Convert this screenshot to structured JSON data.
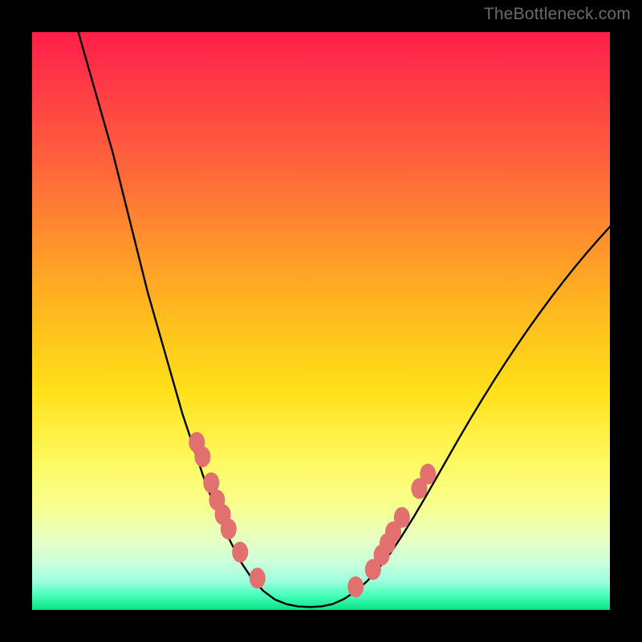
{
  "watermark": "TheBottleneck.com",
  "chart_data": {
    "type": "line",
    "title": "",
    "xlabel": "",
    "ylabel": "",
    "xlim": [
      0,
      100
    ],
    "ylim": [
      0,
      100
    ],
    "curve": {
      "points": [
        [
          8,
          100
        ],
        [
          10,
          93
        ],
        [
          12,
          86
        ],
        [
          14,
          79
        ],
        [
          16,
          71
        ],
        [
          18,
          63
        ],
        [
          20,
          55
        ],
        [
          22,
          48
        ],
        [
          24,
          41
        ],
        [
          26,
          34
        ],
        [
          28,
          28
        ],
        [
          30,
          22
        ],
        [
          32,
          17
        ],
        [
          34,
          12.5
        ],
        [
          36,
          8.5
        ],
        [
          38,
          5.5
        ],
        [
          40,
          3.3
        ],
        [
          42,
          1.8
        ],
        [
          44,
          1.0
        ],
        [
          46,
          0.6
        ],
        [
          48,
          0.5
        ],
        [
          50,
          0.6
        ],
        [
          52,
          1.0
        ],
        [
          54,
          1.9
        ],
        [
          56,
          3.2
        ],
        [
          58,
          5.0
        ],
        [
          60,
          7.2
        ],
        [
          62,
          9.8
        ],
        [
          64,
          12.8
        ],
        [
          66,
          16.0
        ],
        [
          68,
          19.4
        ],
        [
          70,
          22.9
        ],
        [
          72,
          26.4
        ],
        [
          74,
          29.9
        ],
        [
          76,
          33.3
        ],
        [
          78,
          36.6
        ],
        [
          80,
          39.8
        ],
        [
          82,
          42.9
        ],
        [
          84,
          45.9
        ],
        [
          86,
          48.8
        ],
        [
          88,
          51.6
        ],
        [
          90,
          54.3
        ],
        [
          92,
          56.9
        ],
        [
          94,
          59.4
        ],
        [
          96,
          61.8
        ],
        [
          98,
          64.1
        ],
        [
          100,
          66.3
        ]
      ]
    },
    "markers_left": [
      [
        28.5,
        29.0
      ],
      [
        29.5,
        26.5
      ],
      [
        31.0,
        22.0
      ],
      [
        32.0,
        19.0
      ],
      [
        33.0,
        16.5
      ],
      [
        34.0,
        14.0
      ],
      [
        36.0,
        10.0
      ],
      [
        39.0,
        5.5
      ]
    ],
    "markers_right": [
      [
        56.0,
        4.0
      ],
      [
        59.0,
        7.0
      ],
      [
        60.5,
        9.5
      ],
      [
        61.5,
        11.5
      ],
      [
        62.5,
        13.5
      ],
      [
        64.0,
        16.0
      ],
      [
        67.0,
        21.0
      ],
      [
        68.5,
        23.5
      ]
    ],
    "marker_color": "#e2706f",
    "curve_color": "#000000"
  }
}
